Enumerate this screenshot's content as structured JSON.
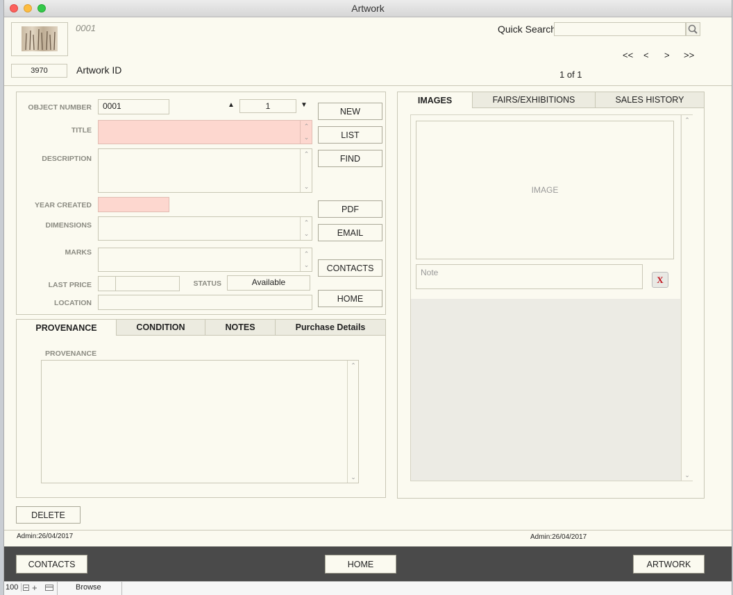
{
  "window": {
    "title": "Artwork"
  },
  "header": {
    "object_number_display": "0001",
    "record_id": "3970",
    "record_id_label": "Artwork ID",
    "quick_search_label": "Quick Search",
    "quick_search_value": "",
    "nav": {
      "first": "<<",
      "prev": "<",
      "next": ">",
      "last": ">>"
    },
    "record_position": "1 of 1"
  },
  "form": {
    "object_number_label": "OBJECT NUMBER",
    "object_number_value": "0001",
    "copy_number_value": "1",
    "title_label": "TITLE",
    "title_value": "",
    "description_label": "DESCRIPTION",
    "description_value": "",
    "year_created_label": "YEAR CREATED",
    "year_created_value": "",
    "dimensions_label": "DIMENSIONS",
    "dimensions_value": "",
    "marks_label": "MARKS",
    "marks_value": "",
    "last_price_label": "LAST PRICE",
    "last_price_currency": "",
    "last_price_value": "",
    "status_label": "STATUS",
    "status_value": "Available",
    "location_label": "LOCATION",
    "location_value": ""
  },
  "actions": {
    "new": "NEW",
    "list": "LIST",
    "find": "FIND",
    "pdf": "PDF",
    "email": "EMAIL",
    "contacts": "CONTACTS",
    "home": "HOME"
  },
  "lower_tabs": {
    "items": [
      {
        "label": "PROVENANCE",
        "active": true
      },
      {
        "label": "CONDITION",
        "active": false
      },
      {
        "label": "NOTES",
        "active": false
      },
      {
        "label": "Purchase Details",
        "active": false
      }
    ],
    "provenance_label": "PROVENANCE",
    "provenance_value": ""
  },
  "right_tabs": {
    "items": [
      {
        "label": "IMAGES",
        "active": true
      },
      {
        "label": "FAIRS/EXHIBITIONS",
        "active": false
      },
      {
        "label": "SALES HISTORY",
        "active": false
      }
    ],
    "image_placeholder": "IMAGE",
    "note_placeholder": "Note",
    "delete_note_glyph": "X"
  },
  "delete_button": "DELETE",
  "audit": {
    "left": "Admin:26/04/2017",
    "right": "Admin:26/04/2017"
  },
  "footer": {
    "contacts": "CONTACTS",
    "home": "HOME",
    "artwork": "ARTWORK"
  },
  "statusbar": {
    "zoom": "100",
    "mode": "Browse"
  },
  "colors": {
    "window_bg": "#fbfaf0",
    "required_field": "#fdd7cf",
    "footer_bg": "#4a4a4a",
    "close": "#fc605c",
    "minimize": "#fdbc40",
    "zoom": "#34c84a"
  }
}
